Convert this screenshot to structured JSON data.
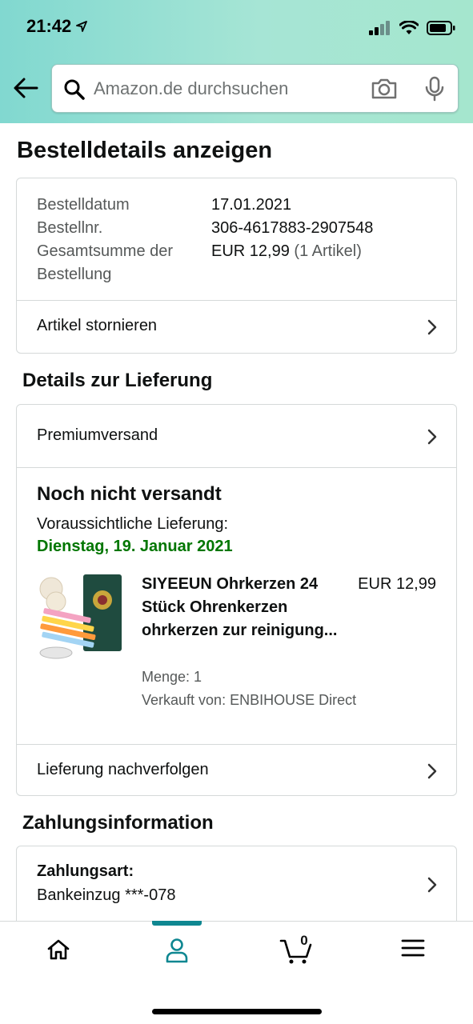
{
  "status_bar": {
    "time": "21:42"
  },
  "search": {
    "placeholder": "Amazon.de durchsuchen"
  },
  "page_title": "Bestelldetails anzeigen",
  "order_summary": {
    "date_label": "Bestelldatum",
    "date_value": "17.01.2021",
    "number_label": "Bestellnr.",
    "number_value": "306-4617883-2907548",
    "total_label_1": "Gesamtsumme der",
    "total_label_2": "Bestellung",
    "total_value": "EUR 12,99",
    "total_count": "(1 Artikel)",
    "cancel_label": "Artikel stornieren"
  },
  "delivery": {
    "section_title": "Details zur Lieferung",
    "shipping_method": "Premiumversand",
    "status_title": "Noch nicht versandt",
    "expected_label": "Voraussichtliche Lieferung:",
    "expected_date": "Dienstag, 19. Januar 2021",
    "colors": {
      "date": "#007600"
    },
    "product": {
      "name": "SIYEEUN Ohrkerzen 24 Stück Ohrenkerzen ohrkerzen zur reinigung...",
      "price": "EUR 12,99",
      "quantity": "Menge: 1",
      "seller": "Verkauft von: ENBIHOUSE Direct"
    },
    "track_label": "Lieferung nachverfolgen"
  },
  "payment": {
    "section_title": "Zahlungsinformation",
    "method_label": "Zahlungsart:",
    "method_value": "Bankeinzug ***-078"
  },
  "bottom_nav": {
    "cart_count": "0",
    "items": [
      "home-icon",
      "account-icon",
      "cart-icon",
      "menu-icon"
    ],
    "active": "account-icon",
    "accent": "#0f8791"
  }
}
